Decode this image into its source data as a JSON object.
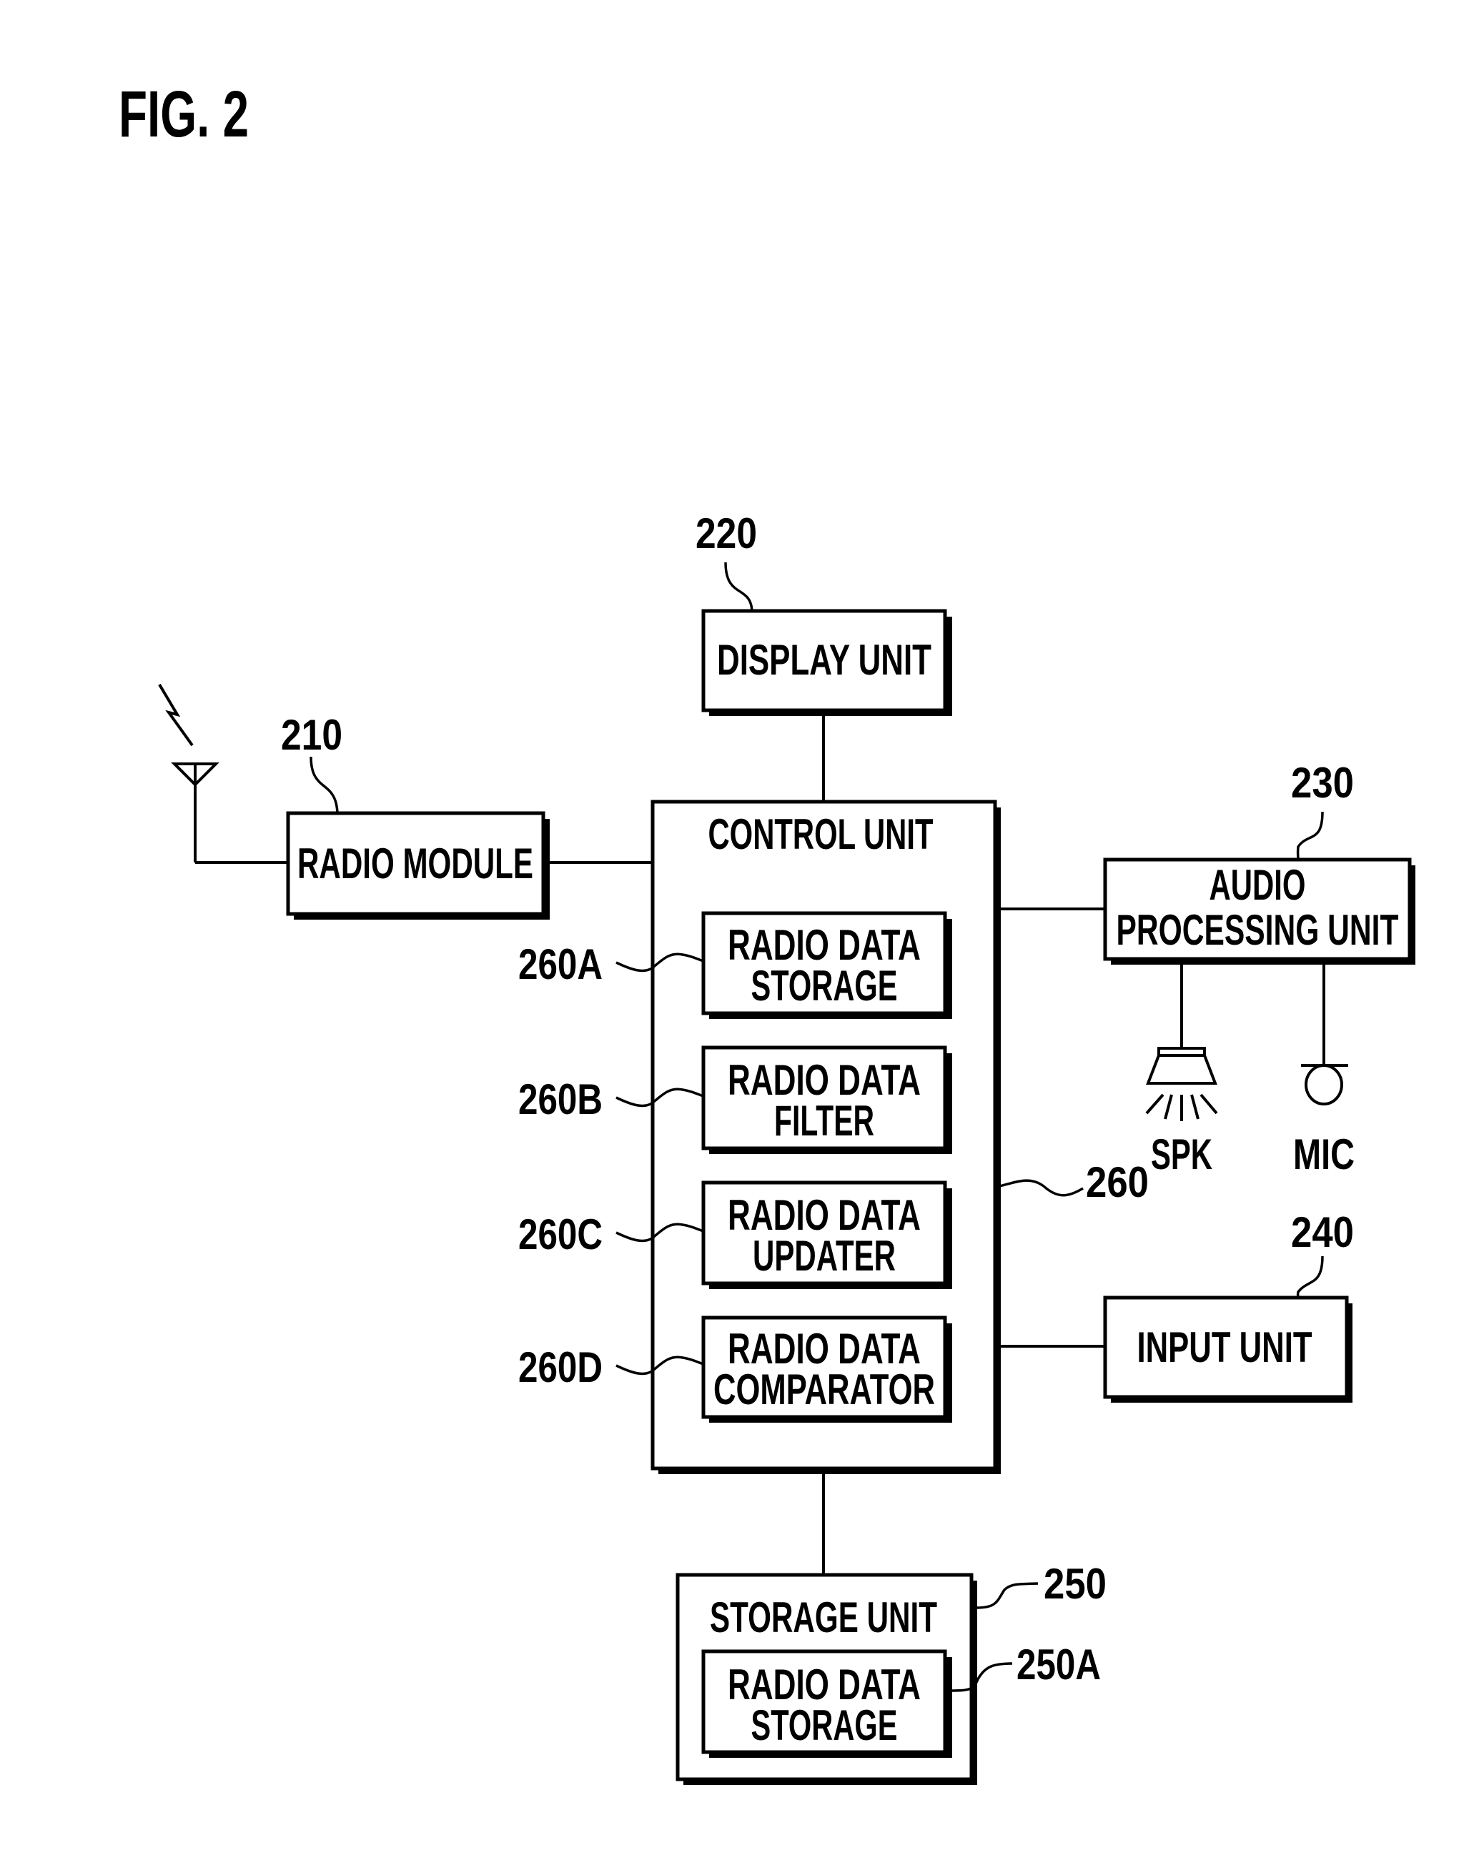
{
  "figure": {
    "title": "FIG. 2"
  },
  "antenna": {
    "icon": "antenna-icon",
    "signal_icon": "lightning-icon"
  },
  "blocks": {
    "radio_module": {
      "ref": "210",
      "lines": [
        "RADIO MODULE"
      ]
    },
    "display_unit": {
      "ref": "220",
      "lines": [
        "DISPLAY UNIT"
      ]
    },
    "control_unit": {
      "ref": "260",
      "lines": [
        "CONTROL UNIT"
      ]
    },
    "radio_data_storage": {
      "ref": "260A",
      "lines": [
        "RADIO DATA",
        "STORAGE"
      ]
    },
    "radio_data_filter": {
      "ref": "260B",
      "lines": [
        "RADIO DATA",
        "FILTER"
      ]
    },
    "radio_data_updater": {
      "ref": "260C",
      "lines": [
        "RADIO DATA",
        "UPDATER"
      ]
    },
    "radio_data_comparator": {
      "ref": "260D",
      "lines": [
        "RADIO DATA",
        "COMPARATOR"
      ]
    },
    "audio_processing_unit": {
      "ref": "230",
      "lines": [
        "AUDIO",
        "PROCESSING UNIT"
      ]
    },
    "input_unit": {
      "ref": "240",
      "lines": [
        "INPUT UNIT"
      ]
    },
    "storage_unit": {
      "ref": "250",
      "lines": [
        "STORAGE UNIT"
      ]
    },
    "storage_radio_data_storage": {
      "ref": "250A",
      "lines": [
        "RADIO DATA",
        "STORAGE"
      ]
    }
  },
  "peripherals": {
    "speaker": {
      "label": "SPK",
      "icon": "speaker-icon"
    },
    "microphone": {
      "label": "MIC",
      "icon": "microphone-icon"
    }
  },
  "colors": {
    "ink": "#000000",
    "paper": "#ffffff"
  }
}
